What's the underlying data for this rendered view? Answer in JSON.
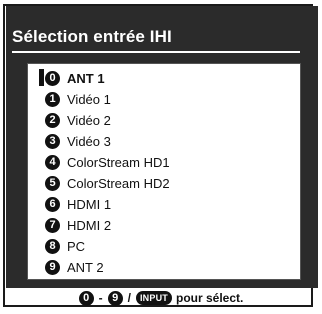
{
  "menu": {
    "title": "Sélection entrée IHI",
    "selected_index": 0,
    "items": [
      {
        "num": "0",
        "label": "ANT 1",
        "selected": true
      },
      {
        "num": "1",
        "label": "Vidéo 1"
      },
      {
        "num": "2",
        "label": "Vidéo 2"
      },
      {
        "num": "3",
        "label": "Vidéo 3"
      },
      {
        "num": "4",
        "label": "ColorStream HD1"
      },
      {
        "num": "5",
        "label": "ColorStream HD2"
      },
      {
        "num": "6",
        "label": "HDMI 1"
      },
      {
        "num": "7",
        "label": "HDMI 2"
      },
      {
        "num": "8",
        "label": "PC"
      },
      {
        "num": "9",
        "label": "ANT 2"
      }
    ]
  },
  "footer": {
    "start_key": "0",
    "dash": "-",
    "end_key": "9",
    "slash": "/",
    "input_key_label": "INPUT",
    "text": "pour sélect."
  },
  "colors": {
    "osd_background": "#2b2b2b",
    "list_background": "#ffffff",
    "badge": "#111111"
  },
  "icons": {
    "number_badge": "circled-number-icon",
    "input_key": "input-button-icon",
    "cursor": "selection-cursor-bar"
  }
}
